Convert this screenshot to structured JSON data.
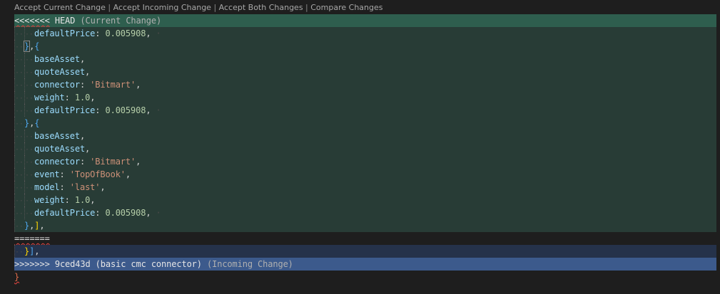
{
  "codelens": {
    "accept_current": "Accept Current Change",
    "accept_incoming": "Accept Incoming Change",
    "accept_both": "Accept Both Changes",
    "compare": "Compare Changes",
    "separator": " | "
  },
  "current_header": {
    "marker": "<<<<<<<",
    "name": "HEAD",
    "label": "(Current Change)"
  },
  "current_lines": [
    {
      "indent": 2,
      "parts": [
        [
          "key",
          "defaultPrice"
        ],
        [
          "pun",
          ": "
        ],
        [
          "num",
          "0.005908"
        ],
        [
          "pun",
          ","
        ],
        [
          "ws",
          " ·"
        ]
      ]
    },
    {
      "indent": 1,
      "parts": [
        [
          "brace-blue bracket-box",
          "}"
        ],
        [
          "pun",
          ","
        ],
        [
          "brace-blue",
          "{"
        ]
      ]
    },
    {
      "indent": 2,
      "parts": [
        [
          "key",
          "baseAsset"
        ],
        [
          "pun",
          ","
        ]
      ]
    },
    {
      "indent": 2,
      "parts": [
        [
          "key",
          "quoteAsset"
        ],
        [
          "pun",
          ","
        ]
      ]
    },
    {
      "indent": 2,
      "parts": [
        [
          "key",
          "connector"
        ],
        [
          "pun",
          ": "
        ],
        [
          "str",
          "'Bitmart'"
        ],
        [
          "pun",
          ","
        ]
      ]
    },
    {
      "indent": 2,
      "parts": [
        [
          "key",
          "weight"
        ],
        [
          "pun",
          ": "
        ],
        [
          "num",
          "1.0"
        ],
        [
          "pun",
          ","
        ]
      ]
    },
    {
      "indent": 2,
      "parts": [
        [
          "key",
          "defaultPrice"
        ],
        [
          "pun",
          ": "
        ],
        [
          "num",
          "0.005908"
        ],
        [
          "pun",
          ","
        ],
        [
          "ws",
          " ·"
        ]
      ]
    },
    {
      "indent": 1,
      "parts": [
        [
          "brace-blue",
          "}"
        ],
        [
          "pun",
          ","
        ],
        [
          "brace-blue",
          "{"
        ]
      ]
    },
    {
      "indent": 2,
      "parts": [
        [
          "key",
          "baseAsset"
        ],
        [
          "pun",
          ","
        ]
      ]
    },
    {
      "indent": 2,
      "parts": [
        [
          "key",
          "quoteAsset"
        ],
        [
          "pun",
          ","
        ]
      ]
    },
    {
      "indent": 2,
      "parts": [
        [
          "key",
          "connector"
        ],
        [
          "pun",
          ": "
        ],
        [
          "str",
          "'Bitmart'"
        ],
        [
          "pun",
          ","
        ]
      ]
    },
    {
      "indent": 2,
      "parts": [
        [
          "key",
          "event"
        ],
        [
          "pun",
          ": "
        ],
        [
          "str",
          "'TopOfBook'"
        ],
        [
          "pun",
          ","
        ]
      ]
    },
    {
      "indent": 2,
      "parts": [
        [
          "key",
          "model"
        ],
        [
          "pun",
          ": "
        ],
        [
          "str",
          "'last'"
        ],
        [
          "pun",
          ","
        ]
      ]
    },
    {
      "indent": 2,
      "parts": [
        [
          "key",
          "weight"
        ],
        [
          "pun",
          ": "
        ],
        [
          "num",
          "1.0"
        ],
        [
          "pun",
          ","
        ]
      ]
    },
    {
      "indent": 2,
      "parts": [
        [
          "key",
          "defaultPrice"
        ],
        [
          "pun",
          ": "
        ],
        [
          "num",
          "0.005908"
        ],
        [
          "pun",
          ","
        ],
        [
          "ws",
          " ·"
        ]
      ]
    },
    {
      "indent": 1,
      "parts": [
        [
          "brace-blue",
          "}"
        ],
        [
          "pun",
          ","
        ],
        [
          "brace-yellow",
          "]"
        ],
        [
          "pun",
          ","
        ]
      ]
    }
  ],
  "separator_marker": "=======",
  "incoming_lines": [
    {
      "indent": 1,
      "parts": [
        [
          "brace-yellow",
          "}"
        ],
        [
          "brace-blue",
          "]"
        ],
        [
          "pun",
          ","
        ]
      ]
    }
  ],
  "incoming_header": {
    "marker": ">>>>>>>",
    "name": "9ced43d (basic cmc connector)",
    "label": "(Incoming Change)"
  },
  "trailing_lines": [
    {
      "indent": 0,
      "parts": [
        [
          "brace-orange",
          "}"
        ]
      ]
    }
  ]
}
